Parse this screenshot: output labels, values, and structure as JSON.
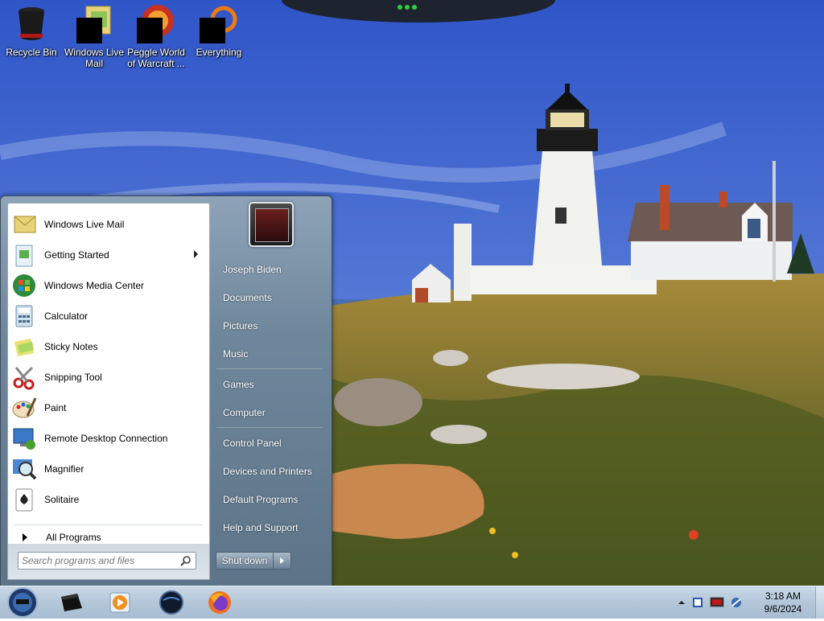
{
  "desktop": {
    "icons": [
      {
        "label_line1": "Recycle Bin",
        "label_line2": "",
        "icon": "recycle-bin-icon"
      },
      {
        "label_line1": "Windows Live",
        "label_line2": "Mail",
        "icon": "windows-live-mail-icon"
      },
      {
        "label_line1": "Peggle World",
        "label_line2": "of Warcraft ...",
        "icon": "peggle-icon"
      },
      {
        "label_line1": "Everything",
        "label_line2": "",
        "icon": "everything-search-icon"
      }
    ]
  },
  "start_menu": {
    "programs": [
      {
        "label": "Windows Live Mail",
        "icon": "windows-live-mail-icon",
        "submenu": false
      },
      {
        "label": "Getting Started",
        "icon": "getting-started-icon",
        "submenu": true
      },
      {
        "label": "Windows Media Center",
        "icon": "media-center-icon",
        "submenu": false
      },
      {
        "label": "Calculator",
        "icon": "calculator-icon",
        "submenu": false
      },
      {
        "label": "Sticky Notes",
        "icon": "sticky-notes-icon",
        "submenu": false
      },
      {
        "label": "Snipping Tool",
        "icon": "scissors-icon",
        "submenu": false
      },
      {
        "label": "Paint",
        "icon": "paint-palette-icon",
        "submenu": false
      },
      {
        "label": "Remote Desktop Connection",
        "icon": "remote-desktop-icon",
        "submenu": false
      },
      {
        "label": "Magnifier",
        "icon": "magnifier-icon",
        "submenu": false
      },
      {
        "label": "Solitaire",
        "icon": "solitaire-cards-icon",
        "submenu": false
      }
    ],
    "all_programs_label": "All Programs",
    "search_placeholder": "Search programs and files",
    "right_items": [
      "Joseph Biden",
      "Documents",
      "Pictures",
      "Music",
      "Games",
      "Computer",
      "Control Panel",
      "Devices and Printers",
      "Default Programs",
      "Help and Support"
    ],
    "shutdown_label": "Shut down"
  },
  "taskbar": {
    "pinned": [
      "media-player-icon-black",
      "windows-media-player-icon",
      "globe-icon",
      "firefox-icon"
    ],
    "tray": [
      "show-hidden-icons-arrow",
      "action-center-flag-icon",
      "display-icon",
      "network-icon"
    ],
    "clock_time": "3:18 AM",
    "clock_date": "9/6/2024"
  }
}
